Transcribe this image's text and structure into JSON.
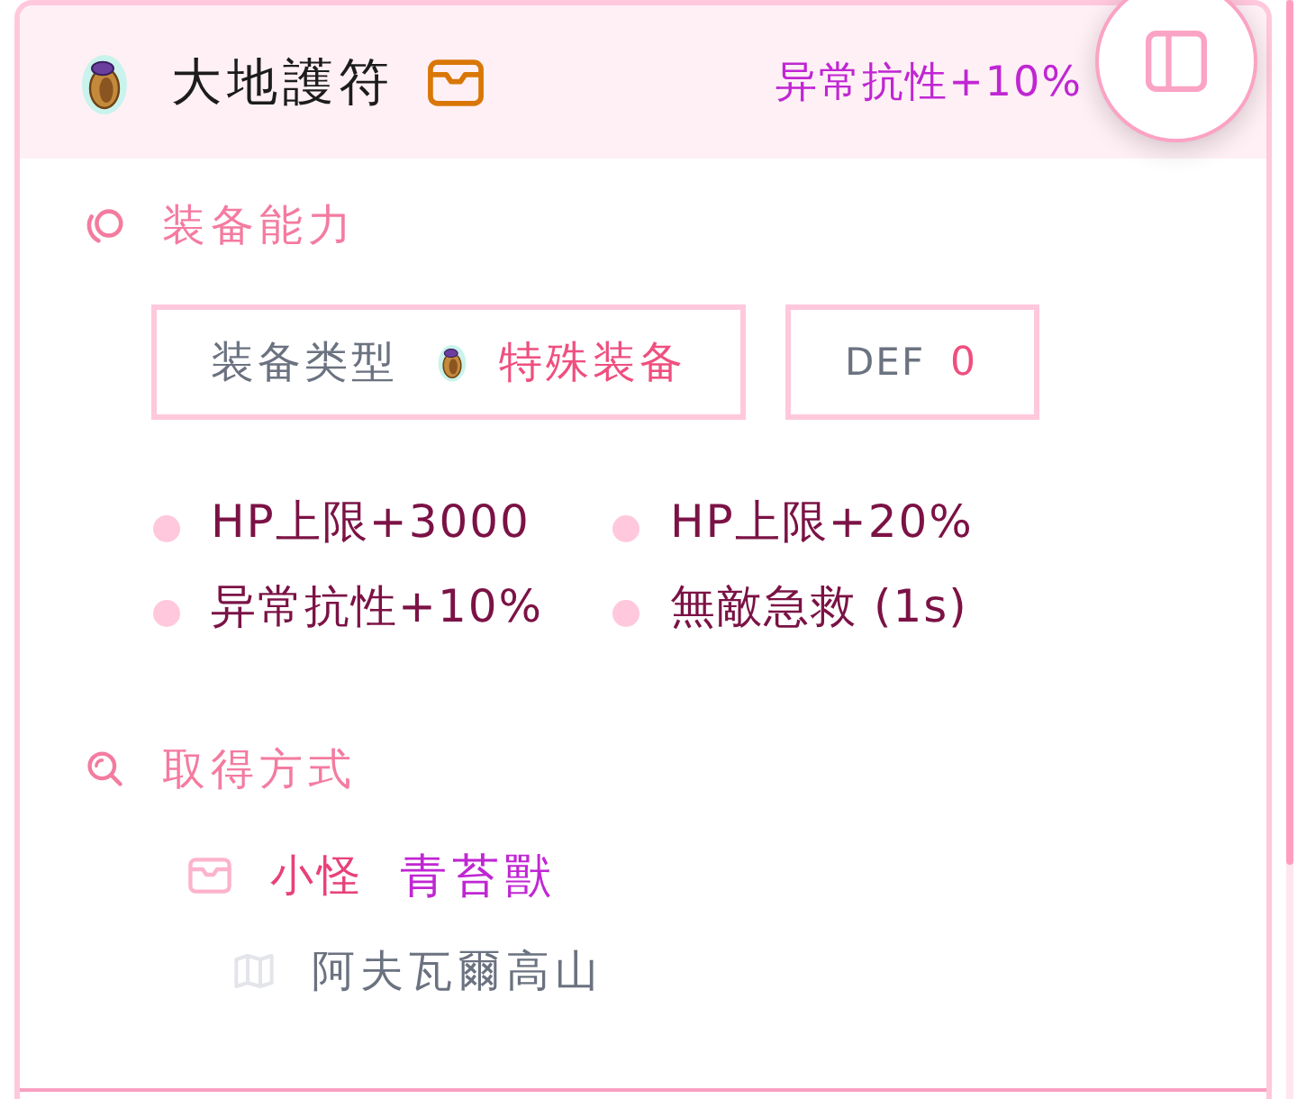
{
  "header": {
    "name": "大地護符",
    "effect": "异常抗性+10%"
  },
  "abilities": {
    "title": "装备能力",
    "type_label": "装备类型",
    "type_value": "特殊装备",
    "def_label": "DEF",
    "def_value": "0",
    "stats": [
      "HP上限+3000",
      "HP上限+20%",
      "异常抗性+10%",
      "無敵急救 (1s)"
    ]
  },
  "acquisition": {
    "title": "取得方式",
    "sources": [
      {
        "category": "小怪",
        "name": "青苔獸",
        "location": "阿夫瓦爾高山"
      }
    ]
  }
}
